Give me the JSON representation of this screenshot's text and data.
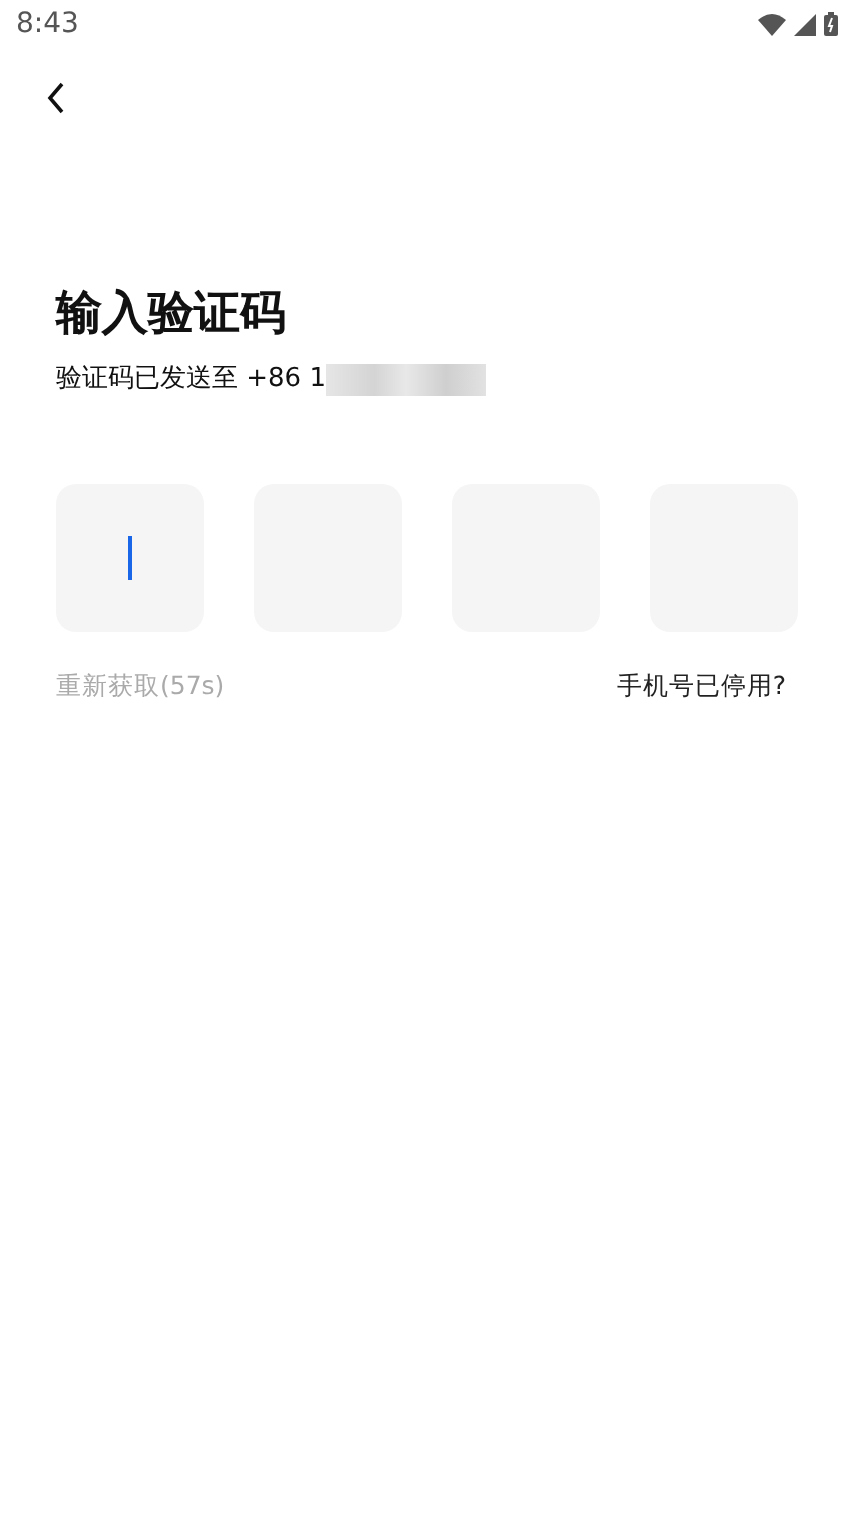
{
  "status_bar": {
    "time": "8:43"
  },
  "title": "输入验证码",
  "subtitle": "验证码已发送至 +86 1",
  "code_boxes": [
    {
      "focused": true
    },
    {
      "focused": false
    },
    {
      "focused": false
    },
    {
      "focused": false
    }
  ],
  "resend": {
    "label": "重新获取(57s)",
    "disabled": true
  },
  "help_link": "手机号已停用?"
}
